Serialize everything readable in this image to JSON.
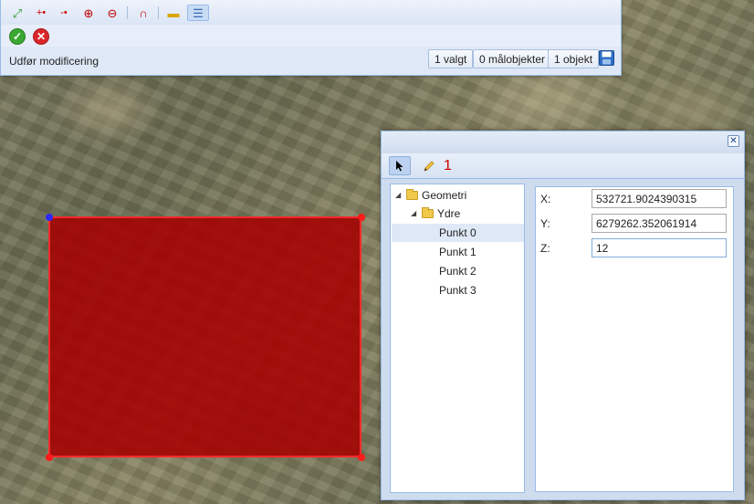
{
  "toolbar": {
    "tools": [
      {
        "icon": "zoom-extent-icon",
        "glyph": "⤢"
      },
      {
        "icon": "add-vertex-icon",
        "glyph": "+•"
      },
      {
        "icon": "remove-vertex-icon",
        "glyph": "-•"
      },
      {
        "icon": "add-polygon-vertex-icon",
        "glyph": "⊕"
      },
      {
        "icon": "remove-polygon-vertex-icon",
        "glyph": "⊖"
      },
      {
        "icon": "snap-magnet-icon",
        "glyph": "∩"
      },
      {
        "icon": "measure-ruler-icon",
        "glyph": "▬"
      },
      {
        "icon": "attribute-table-icon",
        "glyph": "☰"
      }
    ],
    "confirm_glyph": "✓",
    "cancel_glyph": "✕",
    "colors": {
      "confirm": "#3aa832",
      "cancel": "#d9262a",
      "accent": "#15428b"
    }
  },
  "status": {
    "label": "Udfør modificering",
    "selected": "1 valgt",
    "targets": "0 målobjekter",
    "objects": "1 objekt",
    "save_icon": "save-floppy-icon"
  },
  "dialog": {
    "close_glyph": "✕",
    "edit_count": "1",
    "tree": {
      "root": "Geometri",
      "child": "Ydre",
      "points": [
        "Punkt 0",
        "Punkt 1",
        "Punkt 2",
        "Punkt 3"
      ],
      "selected_point": "Punkt 0"
    },
    "fields": {
      "x_label": "X:",
      "x_value": "532721.9024390315",
      "y_label": "Y:",
      "y_value": "6279262.352061914",
      "z_label": "Z:",
      "z_value": "12"
    }
  },
  "map": {
    "polygon_fill": "#a50000",
    "polygon_stroke": "#ff2a2a",
    "selected_vertex_color": "#2a2aff"
  }
}
